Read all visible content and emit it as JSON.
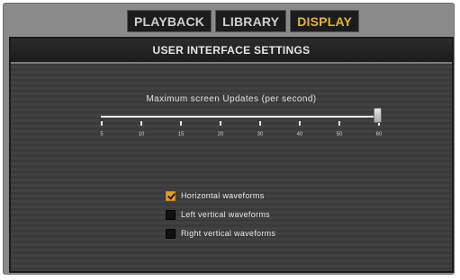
{
  "tabs": [
    {
      "label": "PLAYBACK",
      "active": false
    },
    {
      "label": "LIBRARY",
      "active": false
    },
    {
      "label": "DISPLAY",
      "active": true
    }
  ],
  "colors": {
    "active_tab_text": "#e2b437",
    "checkbox_checked": "#e3a321"
  },
  "panel": {
    "title": "USER INTERFACE SETTINGS"
  },
  "slider": {
    "label": "Maximum screen Updates (per second)",
    "ticks": [
      "5",
      "10",
      "15",
      "20",
      "30",
      "40",
      "50",
      "60"
    ],
    "value": "60"
  },
  "options": [
    {
      "label": "Horizontal waveforms",
      "checked": true
    },
    {
      "label": "Left vertical waveforms",
      "checked": false
    },
    {
      "label": "Right vertical waveforms",
      "checked": false
    }
  ]
}
